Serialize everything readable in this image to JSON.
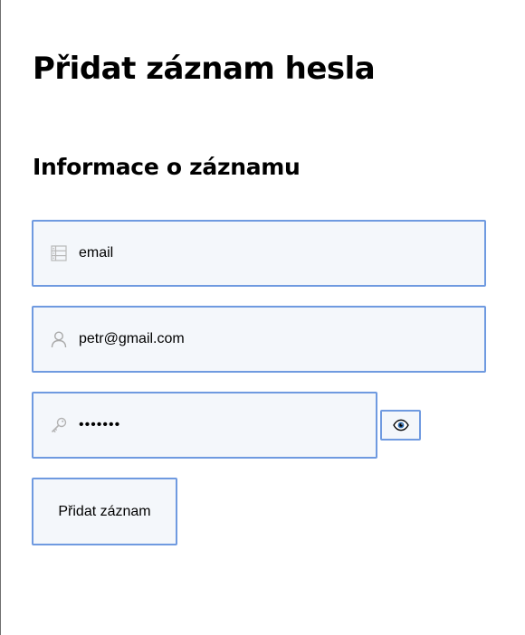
{
  "page": {
    "title": "Přidat záznam hesla",
    "section_title": "Informace o záznamu"
  },
  "form": {
    "type_field": {
      "value": "email",
      "icon": "list-icon"
    },
    "username_field": {
      "value": "petr@gmail.com",
      "icon": "user-icon"
    },
    "password_field": {
      "value": "•••••••",
      "icon": "key-icon"
    },
    "toggle_visibility": {
      "icon": "eye-icon"
    },
    "submit_label": "Přidat záznam"
  },
  "colors": {
    "border": "#6f9ae0",
    "field_background": "#f4f7fb",
    "icon": "#a9a9a9"
  }
}
